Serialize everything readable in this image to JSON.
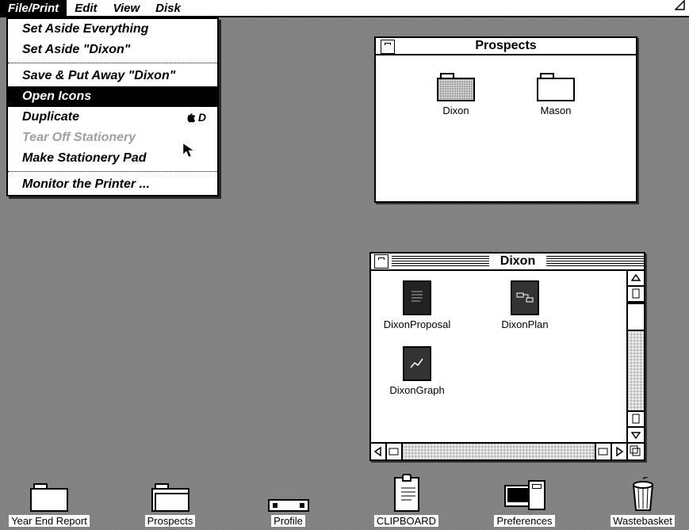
{
  "menubar": {
    "items": [
      {
        "label": "File/Print",
        "active": true
      },
      {
        "label": "Edit",
        "active": false
      },
      {
        "label": "View",
        "active": false
      },
      {
        "label": "Disk",
        "active": false
      }
    ]
  },
  "dropdown": {
    "items": [
      {
        "type": "item",
        "label": "Set Aside Everything"
      },
      {
        "type": "item",
        "label": "Set Aside \"Dixon\""
      },
      {
        "type": "sep"
      },
      {
        "type": "item",
        "label": "Save & Put Away \"Dixon\""
      },
      {
        "type": "item",
        "label": "Open Icons",
        "selected": true
      },
      {
        "type": "item",
        "label": "Duplicate",
        "shortcut": "D"
      },
      {
        "type": "item",
        "label": "Tear Off Stationery",
        "disabled": true
      },
      {
        "type": "item",
        "label": "Make Stationery Pad"
      },
      {
        "type": "sep"
      },
      {
        "type": "item",
        "label": "Monitor the Printer ..."
      }
    ]
  },
  "windows": {
    "prospects": {
      "title": "Prospects",
      "icons": [
        {
          "label": "Dixon",
          "kind": "folder-dither"
        },
        {
          "label": "Mason",
          "kind": "folder"
        }
      ]
    },
    "dixon": {
      "title": "Dixon",
      "icons": [
        {
          "label": "DixonProposal",
          "kind": "doc-dark"
        },
        {
          "label": "DixonPlan",
          "kind": "doc-plan"
        },
        {
          "label": "DixonGraph",
          "kind": "doc-graph"
        }
      ]
    }
  },
  "desktop_icons": [
    {
      "label": "Year End Report",
      "kind": "folder"
    },
    {
      "label": "Prospects",
      "kind": "folder-open"
    },
    {
      "label": "Profile",
      "kind": "disk"
    },
    {
      "label": "CLIPBOARD",
      "kind": "clipboard"
    },
    {
      "label": "Preferences",
      "kind": "preferences"
    },
    {
      "label": "Wastebasket",
      "kind": "trash"
    }
  ]
}
